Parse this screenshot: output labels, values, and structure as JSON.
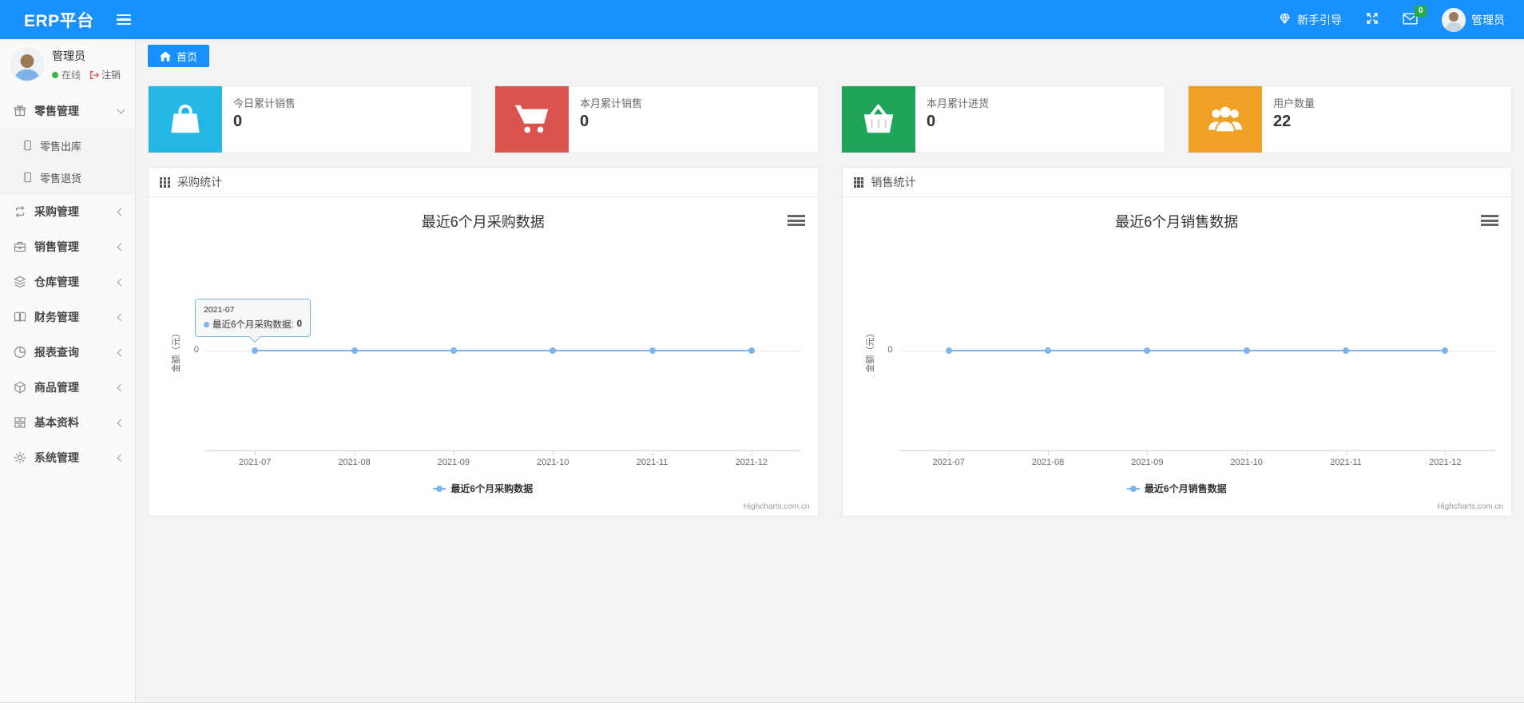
{
  "navbar": {
    "brand": "ERP平台",
    "guide_label": "新手引导",
    "mail_badge": "0",
    "username": "管理员",
    "accent_color": "#1890ff"
  },
  "sidebar": {
    "user": {
      "name": "管理员",
      "status": "在线",
      "logout": "注销"
    },
    "menu": [
      {
        "label": "零售管理",
        "icon": "gift-icon",
        "state": "expanded",
        "children": [
          {
            "label": "零售出库",
            "icon": "file-icon"
          },
          {
            "label": "零售退货",
            "icon": "file-icon"
          }
        ]
      },
      {
        "label": "采购管理",
        "icon": "repeat-icon",
        "state": "collapsed"
      },
      {
        "label": "销售管理",
        "icon": "briefcase-icon",
        "state": "collapsed"
      },
      {
        "label": "仓库管理",
        "icon": "layers-icon",
        "state": "collapsed"
      },
      {
        "label": "财务管理",
        "icon": "book-icon",
        "state": "collapsed"
      },
      {
        "label": "报表查询",
        "icon": "pie-chart-icon",
        "state": "collapsed"
      },
      {
        "label": "商品管理",
        "icon": "box-icon",
        "state": "collapsed"
      },
      {
        "label": "基本资料",
        "icon": "grid-icon",
        "state": "collapsed"
      },
      {
        "label": "系统管理",
        "icon": "gear-icon",
        "state": "collapsed"
      }
    ]
  },
  "breadcrumb": {
    "home": "首页"
  },
  "cards": [
    {
      "label": "今日累计销售",
      "value": "0",
      "icon": "shopping-bag-icon",
      "color": "#23b7e5"
    },
    {
      "label": "本月累计销售",
      "value": "0",
      "icon": "shopping-cart-icon",
      "color": "#d9534f"
    },
    {
      "label": "本月累计进货",
      "value": "0",
      "icon": "basket-icon",
      "color": "#1fa55b"
    },
    {
      "label": "用户数量",
      "value": "22",
      "icon": "users-icon",
      "color": "#f0a125"
    }
  ],
  "chart_data": [
    {
      "type": "line",
      "panel_title": "采购统计",
      "title": "最近6个月采购数据",
      "categories": [
        "2021-07",
        "2021-08",
        "2021-09",
        "2021-10",
        "2021-11",
        "2021-12"
      ],
      "series": [
        {
          "name": "最近6个月采购数据",
          "values": [
            0,
            0,
            0,
            0,
            0,
            0
          ],
          "color": "#7cb5ec"
        }
      ],
      "xlabel": "",
      "ylabel": "金额（元）",
      "yticks": [
        "0"
      ],
      "ylim": [
        -1,
        1
      ],
      "grid": false,
      "legend_position": "bottom",
      "credits": "Highcharts.com.cn",
      "tooltip": {
        "visible": true,
        "point_index": 0,
        "header": "2021-07",
        "label": "最近6个月采购数据:",
        "value": "0"
      }
    },
    {
      "type": "line",
      "panel_title": "销售统计",
      "title": "最近6个月销售数据",
      "categories": [
        "2021-07",
        "2021-08",
        "2021-09",
        "2021-10",
        "2021-11",
        "2021-12"
      ],
      "series": [
        {
          "name": "最近6个月销售数据",
          "values": [
            0,
            0,
            0,
            0,
            0,
            0
          ],
          "color": "#7cb5ec"
        }
      ],
      "xlabel": "",
      "ylabel": "金额（元）",
      "yticks": [
        "0"
      ],
      "ylim": [
        -1,
        1
      ],
      "grid": false,
      "legend_position": "bottom",
      "credits": "Highcharts.com.cn",
      "tooltip": {
        "visible": false
      }
    }
  ]
}
